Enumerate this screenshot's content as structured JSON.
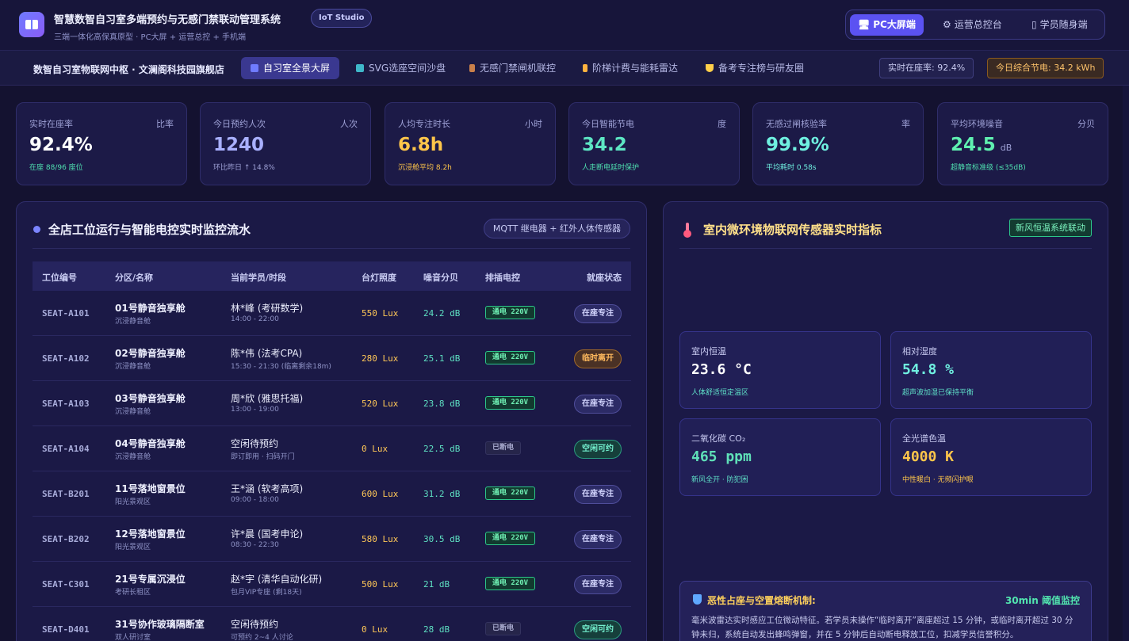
{
  "header": {
    "title": "智慧数智自习室多端预约与无感门禁联动管理系统",
    "badge": "IoT Studio",
    "subtitle": "三端一体化高保真原型 · PC大屏 + 运营总控 + 手机端",
    "modes": [
      {
        "label": "PC大屏端",
        "icon": "monitor-icon",
        "active": true
      },
      {
        "label": "运营总控台",
        "icon": "gear-icon",
        "active": false
      },
      {
        "label": "学员随身端",
        "icon": "phone-icon",
        "active": false
      }
    ]
  },
  "nav": {
    "store": "数智自习室物联网中枢 · 文澜阁科技园旗舰店",
    "tabs": [
      {
        "label": "自习室全景大屏",
        "icon": "chart-icon",
        "color": "#6f7bff"
      },
      {
        "label": "SVG选座空间沙盘",
        "icon": "map-icon",
        "color": "#3fb7c9"
      },
      {
        "label": "无感门禁闸机联控",
        "icon": "door-icon",
        "color": "#c9804a"
      },
      {
        "label": "阶梯计费与能耗雷达",
        "icon": "bolt-icon",
        "color": "#ffb23f"
      },
      {
        "label": "备考专注榜与研友圈",
        "icon": "trophy-icon",
        "color": "#ffcf4a"
      }
    ],
    "occupancy": "实时在座率: 92.4%",
    "energy": "今日综合节电: 34.2 kWh"
  },
  "kpis": [
    {
      "label": "实时在座率",
      "unit": "比率",
      "value": "92.4%",
      "suffix": "",
      "note": "在座 88/96 座位",
      "value_color": "#ffffff",
      "note_color": "#4fe0b0"
    },
    {
      "label": "今日预约人次",
      "unit": "人次",
      "value": "1240",
      "suffix": "",
      "note": "环比昨日 ↑ 14.8%",
      "value_color": "#a9b0ff",
      "note_color": "#9ea1d6"
    },
    {
      "label": "人均专注时长",
      "unit": "小时",
      "value": "6.8h",
      "suffix": "",
      "note": "沉浸舱平均 8.2h",
      "value_color": "#ffc64a",
      "note_color": "#ffc64a"
    },
    {
      "label": "今日智能节电",
      "unit": "度",
      "value": "34.2",
      "suffix": "",
      "note": "人走断电延时保护",
      "value_color": "#5de6c3",
      "note_color": "#4fe0b0"
    },
    {
      "label": "无感过闸核验率",
      "unit": "率",
      "value": "99.9%",
      "suffix": "",
      "note": "平均耗时 0.58s",
      "value_color": "#6ff0e0",
      "note_color": "#6ff0e0"
    },
    {
      "label": "平均环境噪音",
      "unit": "分贝",
      "value": "24.5",
      "suffix": "dB",
      "note": "超静音标准级 (≤35dB)",
      "value_color": "#5ff0b0",
      "note_color": "#4fe0b0"
    }
  ],
  "seat_panel": {
    "title": "全店工位运行与智能电控实时监控流水",
    "tag": "MQTT 继电器 + 红外人体传感器",
    "columns": [
      "工位编号",
      "分区/名称",
      "当前学员/时段",
      "台灯照度",
      "噪音分贝",
      "排插电控",
      "就座状态"
    ],
    "rows": [
      {
        "id": "SEAT-A101",
        "name": "01号静音独享舱",
        "zone": "沉浸静音舱",
        "user": "林*峰 (考研数学)",
        "time": "14:00 - 22:00",
        "lux": "550 Lux",
        "db": "24.2 dB",
        "power": "通电 220V",
        "power_on": true,
        "status": "在座专注",
        "status_kind": "focus"
      },
      {
        "id": "SEAT-A102",
        "name": "02号静音独享舱",
        "zone": "沉浸静音舱",
        "user": "陈*伟 (法考CPA)",
        "time": "15:30 - 21:30 (临离剩余18m)",
        "lux": "280 Lux",
        "db": "25.1 dB",
        "power": "通电 220V",
        "power_on": true,
        "status": "临时离开",
        "status_kind": "leave"
      },
      {
        "id": "SEAT-A103",
        "name": "03号静音独享舱",
        "zone": "沉浸静音舱",
        "user": "周*欣 (雅思托福)",
        "time": "13:00 - 19:00",
        "lux": "520 Lux",
        "db": "23.8 dB",
        "power": "通电 220V",
        "power_on": true,
        "status": "在座专注",
        "status_kind": "focus"
      },
      {
        "id": "SEAT-A104",
        "name": "04号静音独享舱",
        "zone": "沉浸静音舱",
        "user": "空闲待预约",
        "time": "即订即用 · 扫码开门",
        "lux": "0 Lux",
        "db": "22.5 dB",
        "power": "已断电",
        "power_on": false,
        "status": "空闲可约",
        "status_kind": "free"
      },
      {
        "id": "SEAT-B201",
        "name": "11号落地窗景位",
        "zone": "阳光景观区",
        "user": "王*涵 (软考高项)",
        "time": "09:00 - 18:00",
        "lux": "600 Lux",
        "db": "31.2 dB",
        "power": "通电 220V",
        "power_on": true,
        "status": "在座专注",
        "status_kind": "focus"
      },
      {
        "id": "SEAT-B202",
        "name": "12号落地窗景位",
        "zone": "阳光景观区",
        "user": "许*晨 (国考申论)",
        "time": "08:30 - 22:30",
        "lux": "580 Lux",
        "db": "30.5 dB",
        "power": "通电 220V",
        "power_on": true,
        "status": "在座专注",
        "status_kind": "focus"
      },
      {
        "id": "SEAT-C301",
        "name": "21号专属沉浸位",
        "zone": "考研长租区",
        "user": "赵*宇 (清华自动化研)",
        "time": "包月VIP专座 (剩18天)",
        "lux": "500 Lux",
        "db": "21 dB",
        "power": "通电 220V",
        "power_on": true,
        "status": "在座专注",
        "status_kind": "focus"
      },
      {
        "id": "SEAT-D401",
        "name": "31号协作玻璃隔断室",
        "zone": "双人研讨室",
        "user": "空闲待预约",
        "time": "可预约 2~4 人讨论",
        "lux": "0 Lux",
        "db": "28 dB",
        "power": "已断电",
        "power_on": false,
        "status": "空闲可约",
        "status_kind": "free"
      }
    ]
  },
  "env_panel": {
    "title": "室内微环境物联网传感器实时指标",
    "tag": "新风恒温系统联动",
    "sensors": [
      {
        "label": "室内恒温",
        "value": "23.6 °C",
        "note": "人体舒适恒定温区",
        "value_color": "#ffffff",
        "note_color": "#5fe0c8"
      },
      {
        "label": "相对湿度",
        "value": "54.8 %",
        "note": "超声波加湿已保持平衡",
        "value_color": "#6ff0e0",
        "note_color": "#5fe0c8"
      },
      {
        "label": "二氧化碳 CO₂",
        "value": "465 ppm",
        "note": "新风全开 · 防犯困",
        "value_color": "#5fe0b8",
        "note_color": "#5fe0c8"
      },
      {
        "label": "全光谱色温",
        "value": "4000 K",
        "note": "中性暖白 · 无频闪护眼",
        "value_color": "#ffc64a",
        "note_color": "#ffc64a"
      }
    ],
    "mechanism": {
      "title": "恶性占座与空置熔断机制:",
      "threshold": "30min 阈值监控",
      "body": "毫米波雷达实时感应工位微动特征。若学员未操作“临时离开”离座超过 15 分钟，或临时离开超过 30 分钟未归，系统自动发出蜂鸣弹窗，并在 5 分钟后自动断电释放工位，扣减学员信誉积分。"
    }
  }
}
